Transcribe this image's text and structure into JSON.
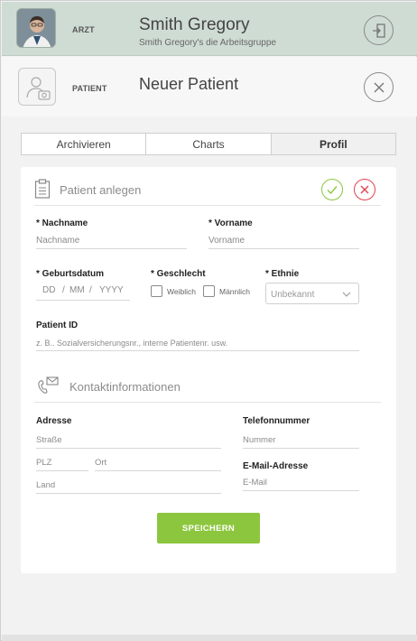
{
  "header": {
    "doctor_role": "ARZT",
    "doctor_name": "Smith Gregory",
    "doctor_group": "Smith Gregory's die Arbeitsgruppe",
    "patient_role": "PATIENT",
    "patient_title": "Neuer Patient"
  },
  "tabs": [
    {
      "label": "Archivieren"
    },
    {
      "label": "Charts"
    },
    {
      "label": "Profil"
    }
  ],
  "form": {
    "section_title": "Patient anlegen",
    "last_name_label": "* Nachname",
    "last_name_placeholder": "Nachname",
    "first_name_label": "* Vorname",
    "first_name_placeholder": "Vorname",
    "birthdate_label": "* Geburtsdatum",
    "birthdate_dd": "DD",
    "birthdate_mm": "MM",
    "birthdate_yyyy": "YYYY",
    "birthdate_sep": "/",
    "gender_label": "* Geschlecht",
    "gender_female": "Weiblich",
    "gender_male": "Männlich",
    "ethnicity_label": "* Ethnie",
    "ethnicity_value": "Unbekannt",
    "patient_id_label": "Patient ID",
    "patient_id_placeholder": "z. B.. Sozialversicherungsnr., interne Patientenr. usw."
  },
  "contact": {
    "section_title": "Kontaktinformationen",
    "address_label": "Adresse",
    "street_placeholder": "Straße",
    "zip_placeholder": "PLZ",
    "city_placeholder": "Ort",
    "country_placeholder": "Land",
    "phone_label": "Telefonnummer",
    "phone_placeholder": "Nummer",
    "email_label": "E-Mail-Adresse",
    "email_placeholder": "E-Mail"
  },
  "actions": {
    "save_label": "SPEICHERN"
  },
  "colors": {
    "accent_green": "#8cc63e",
    "cancel_red": "#e0444c",
    "header_bg": "#cfdcd3"
  }
}
